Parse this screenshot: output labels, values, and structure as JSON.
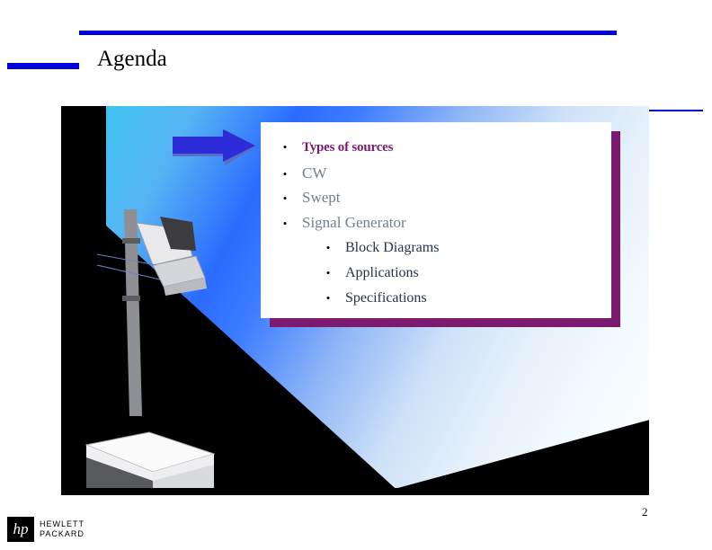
{
  "slide": {
    "title": "Agenda",
    "page_number": "2",
    "accent_color": "#0000dd",
    "card_accent_color": "#7b1a6e",
    "bullet_text_color": "#6f7f8f",
    "sub_bullet_text_color": "#25344a",
    "bullets": [
      {
        "label": "Types of sources",
        "level": 1,
        "highlight": true
      },
      {
        "label": "CW",
        "level": 1,
        "highlight": false
      },
      {
        "label": "Swept",
        "level": 1,
        "highlight": false
      },
      {
        "label": "Signal Generator",
        "level": 1,
        "highlight": false
      },
      {
        "label": "Block Diagrams",
        "level": 2,
        "highlight": false
      },
      {
        "label": "Applications",
        "level": 2,
        "highlight": false
      },
      {
        "label": "Specifications",
        "level": 2,
        "highlight": false
      }
    ],
    "bullet_glyph": "•",
    "arrow_icon": "right-arrow-icon",
    "projector_icon": "overhead-projector-illustration"
  },
  "footer": {
    "logo_mark": "hp",
    "logo_line1": "HEWLETT",
    "logo_line2": "PACKARD"
  }
}
